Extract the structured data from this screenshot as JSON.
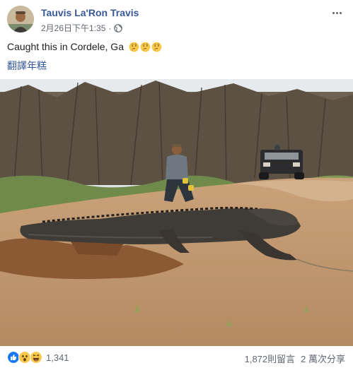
{
  "post": {
    "author": "Tauvis La'Ron Travis",
    "timestamp": "2月26日下午1:35",
    "privacy_icon": "globe-icon",
    "caption": "Caught this in Cordele, Ga",
    "caption_emoji": [
      "thinking-face",
      "thinking-face",
      "thinking-face"
    ],
    "translate_link": "翻譯年糕"
  },
  "footer": {
    "reaction_icons": [
      "like-icon",
      "wow-icon",
      "haha-icon"
    ],
    "reaction_count": "1,341",
    "comments": "1,872則留言",
    "shares": "2 萬次分享"
  },
  "colors": {
    "link": "#385898",
    "text": "#1c1e21",
    "muted": "#606770",
    "like_blue": "#1877f2",
    "emoji_yellow": "#f7c84a"
  }
}
